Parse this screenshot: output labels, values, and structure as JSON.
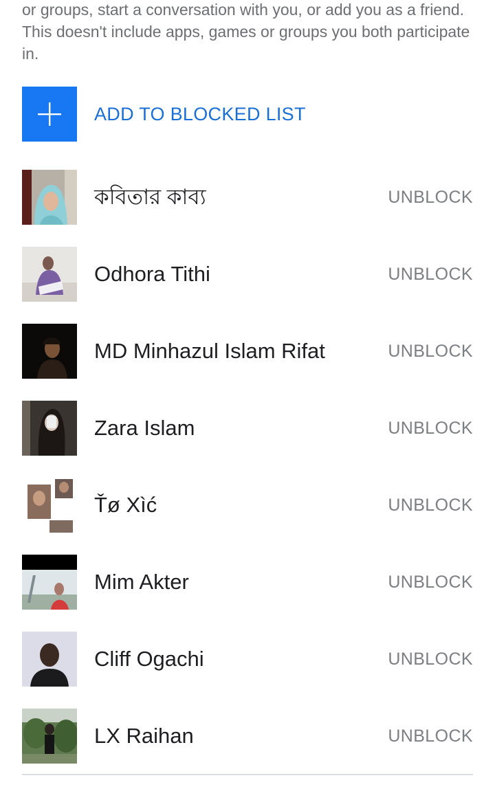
{
  "description": "or groups, start a conversation with you, or add you as a friend. This doesn't include apps, games or groups you both participate in.",
  "add_button": {
    "label": "ADD TO BLOCKED LIST",
    "icon": "plus-icon",
    "color": "#1877f2"
  },
  "blocked_users": [
    {
      "name": "কবিতার কাব্য",
      "action": "UNBLOCK"
    },
    {
      "name": "Odhora Tithi",
      "action": "UNBLOCK"
    },
    {
      "name": "MD Minhazul Islam Rifat",
      "action": "UNBLOCK"
    },
    {
      "name": "Zara Islam",
      "action": "UNBLOCK"
    },
    {
      "name": "Ťø Xìć",
      "action": "UNBLOCK"
    },
    {
      "name": "Mim Akter",
      "action": "UNBLOCK"
    },
    {
      "name": "Cliff Ogachi",
      "action": "UNBLOCK"
    },
    {
      "name": "LX Raihan",
      "action": "UNBLOCK"
    }
  ]
}
